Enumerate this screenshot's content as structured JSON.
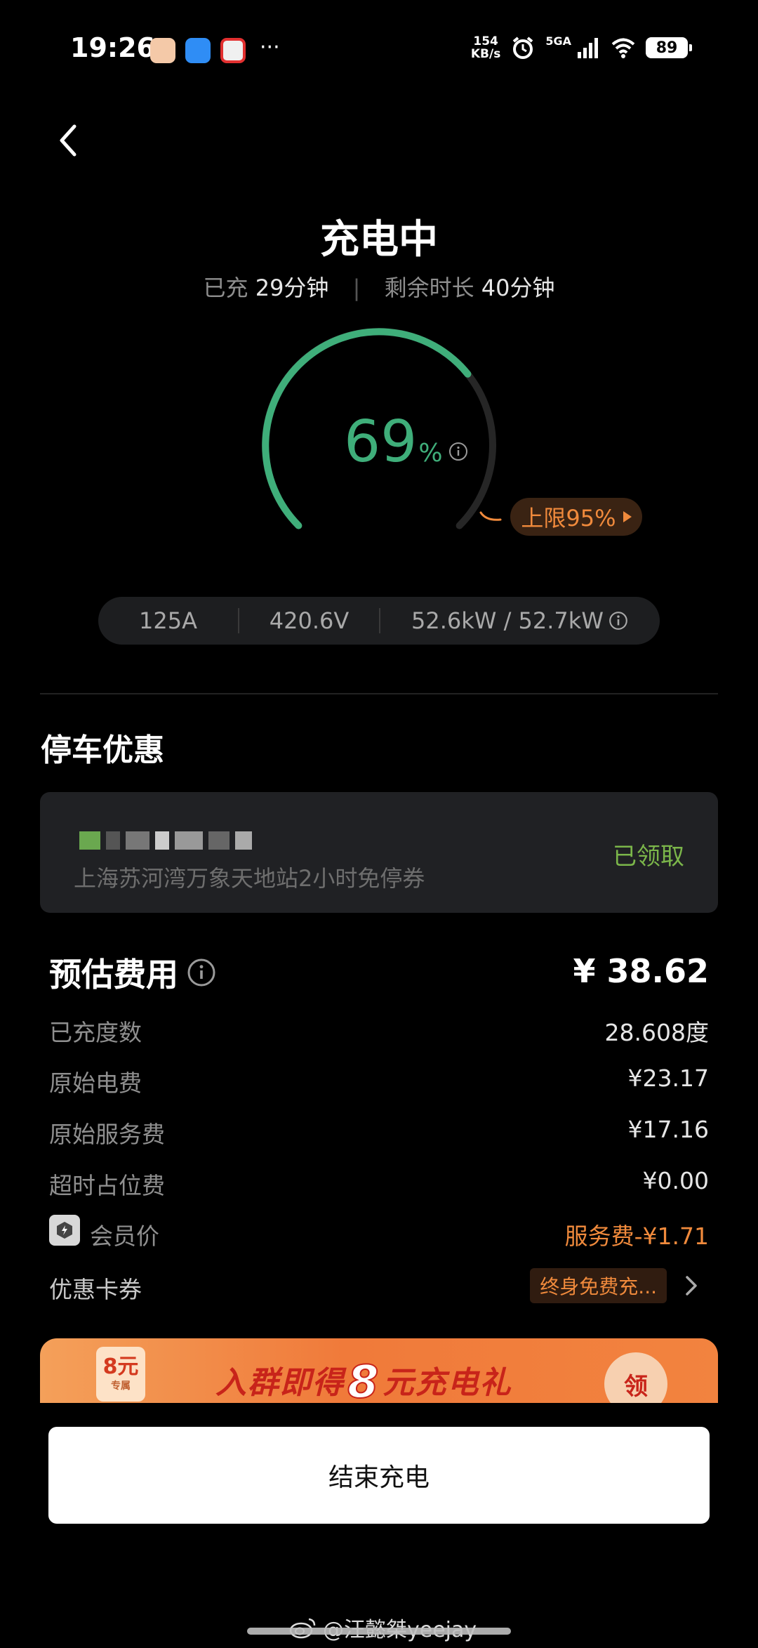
{
  "status_bar": {
    "time": "19:26",
    "net_speed_value": "154",
    "net_speed_unit": "KB/s",
    "signal_label": "5GA",
    "battery": "89",
    "more": "···"
  },
  "header": {
    "title": "充电中"
  },
  "charging": {
    "charged_label": "已充",
    "charged_value": "29分钟",
    "remaining_label": "剩余时长",
    "remaining_value": "40分钟",
    "percent": "69",
    "percent_unit": "%",
    "percent_fraction": 0.69,
    "limit_label": "上限95%",
    "limit_fraction": 0.95,
    "stats": {
      "current": "125A",
      "voltage": "420.6V",
      "power": "52.6kW / 52.7kW"
    }
  },
  "parking": {
    "section_title": "停车优惠",
    "coupon_desc": "上海苏河湾万象天地站2小时免停券",
    "coupon_status": "已领取"
  },
  "fees": {
    "title": "预估费用",
    "total": "¥ 38.62",
    "rows": [
      {
        "label": "已充度数",
        "value": "28.608度"
      },
      {
        "label": "原始电费",
        "value": "¥23.17"
      },
      {
        "label": "原始服务费",
        "value": "¥17.16"
      },
      {
        "label": "超时占位费",
        "value": "¥0.00"
      },
      {
        "label": "会员价",
        "value": "服务费-¥1.71"
      },
      {
        "label": "优惠卡券",
        "value": "终身免费充..."
      }
    ]
  },
  "banner": {
    "badge_amount": "8元",
    "badge_sub": "专属",
    "text_prefix": "入群即得",
    "text_amount": "8",
    "text_suffix": "元充电礼",
    "button": "领"
  },
  "actions": {
    "end_charging": "结束充电"
  },
  "watermark": "@汪懿桀yeejay",
  "colors": {
    "accent_green": "#3fae7a",
    "orange": "#f08a3c",
    "received_green": "#7bb64a"
  }
}
